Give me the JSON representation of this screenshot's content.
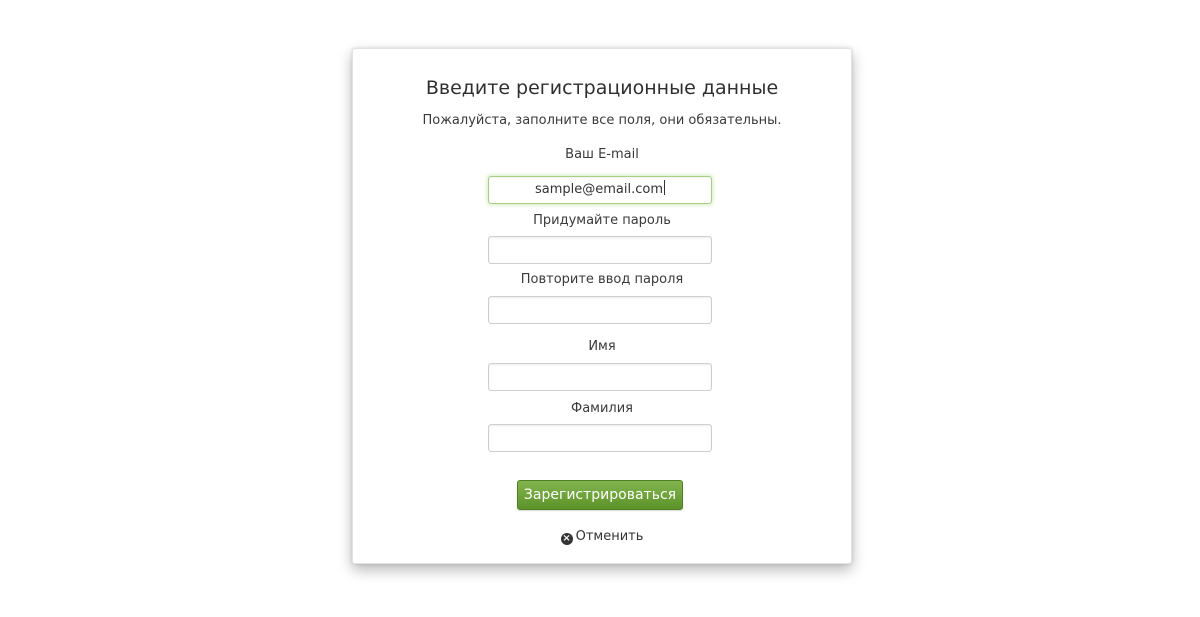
{
  "form": {
    "title": "Введите регистрационные данные",
    "subtitle": "Пожалуйста, заполните все поля, они обязательны.",
    "fields": [
      {
        "label": "Ваш E-mail",
        "value": "sample@email.com",
        "focused": true
      },
      {
        "label": "Придумайте пароль",
        "value": ""
      },
      {
        "label": "Повторите ввод пароля",
        "value": ""
      },
      {
        "label": "Имя",
        "value": ""
      },
      {
        "label": "Фамилия",
        "value": ""
      }
    ],
    "submit_label": "Зарегистрироваться",
    "cancel_label": "Отменить",
    "cancel_icon": "close-circle-icon"
  },
  "colors": {
    "button": "#6aa137",
    "focus_border": "#a8cf86"
  }
}
